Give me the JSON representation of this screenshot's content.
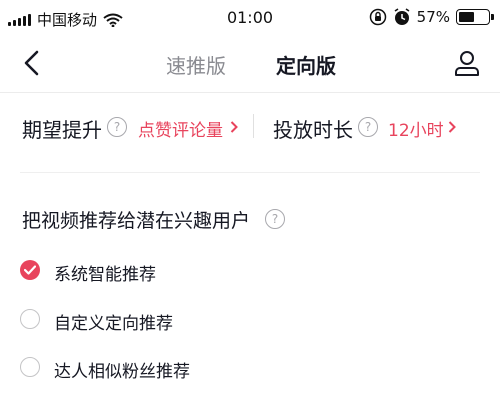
{
  "status_bar": {
    "carrier": "中国移动",
    "time": "01:00",
    "battery": "57%",
    "battery_level": 0.57
  },
  "nav": {
    "tabs": [
      {
        "label": "速推版",
        "active": false
      },
      {
        "label": "定向版",
        "active": true
      }
    ],
    "icons": {
      "back": "chevron-left-icon",
      "profile": "user-icon"
    }
  },
  "settings": {
    "expected_boost": {
      "label": "期望提升",
      "value": "点赞评论量"
    },
    "duration": {
      "label": "投放时长",
      "value": "12小时"
    }
  },
  "recommend": {
    "title": "把视频推荐给潜在兴趣用户",
    "options": [
      {
        "label": "系统智能推荐",
        "selected": true
      },
      {
        "label": "自定义定向推荐",
        "selected": false
      },
      {
        "label": "达人相似粉丝推荐",
        "selected": false
      }
    ]
  },
  "colors": {
    "accent": "#e8445d",
    "text": "#161823",
    "inactive_tab": "#8a8b91"
  }
}
